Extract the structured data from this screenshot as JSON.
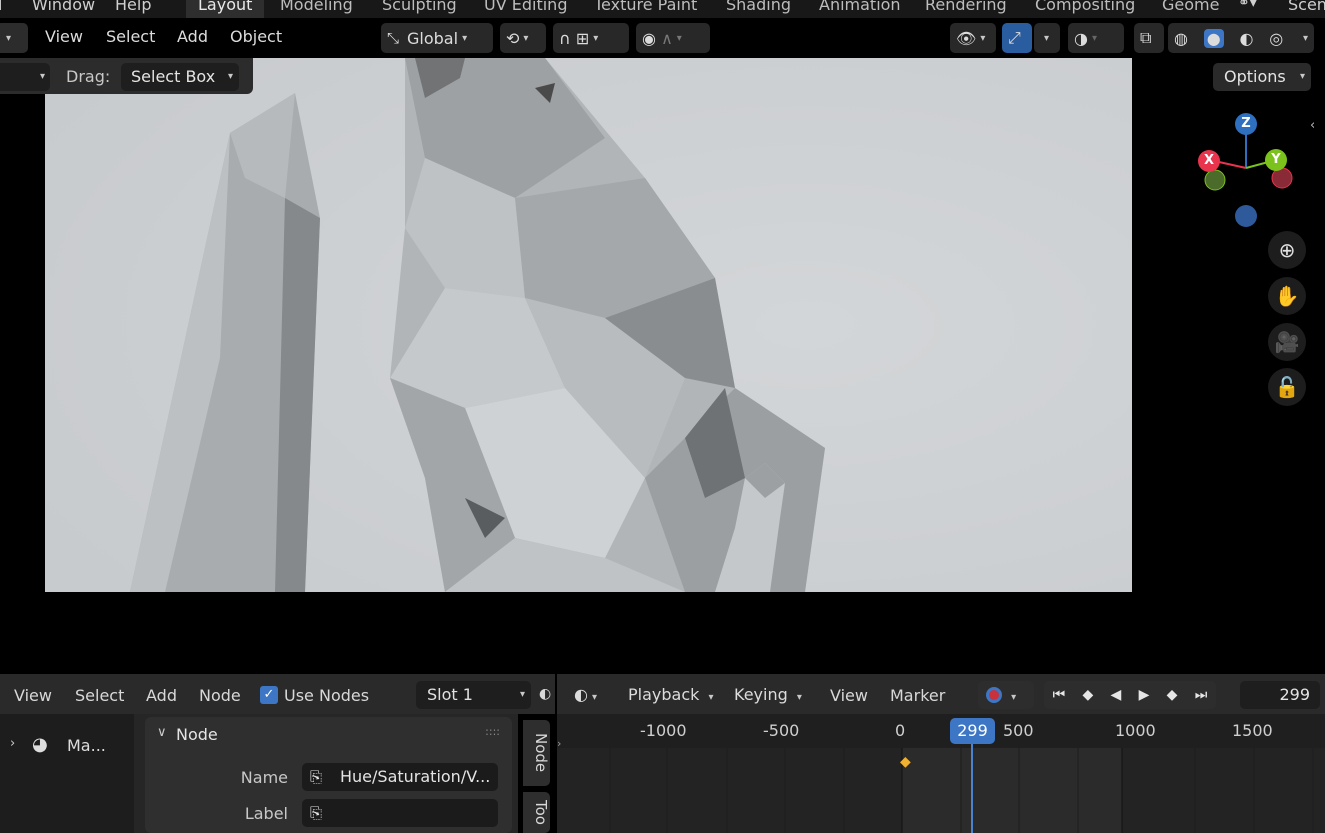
{
  "topbar": {
    "menus": [
      "Window",
      "Help"
    ],
    "workspace_tabs": [
      "Layout",
      "Modeling",
      "Sculpting",
      "UV Editing",
      "Texture Paint",
      "Shading",
      "Animation",
      "Rendering",
      "Compositing",
      "Geome"
    ],
    "active_tab": "Layout",
    "scene_label": "Scen"
  },
  "viewport_header": {
    "menus": [
      "View",
      "Select",
      "Add",
      "Object"
    ],
    "transform_orientation": "Global"
  },
  "tool_header": {
    "drag_label": "Drag:",
    "drag_value": "Select Box",
    "options_label": "Options"
  },
  "gizmo": {
    "x": "X",
    "y": "Y",
    "z": "Z",
    "colors": {
      "x": "#e8344c",
      "y": "#7cc21c",
      "z": "#2e6fc0"
    }
  },
  "node_editor": {
    "menus": [
      "View",
      "Select",
      "Add",
      "Node"
    ],
    "use_nodes_label": "Use Nodes",
    "slot": "Slot 1",
    "outliner_item": "Ma...",
    "panel_title": "Node",
    "name_label": "Name",
    "name_value": "Hue/Saturation/V...",
    "label_label": "Label",
    "label_value": "",
    "tabs": [
      "Node",
      "Too"
    ]
  },
  "timeline": {
    "playback_label": "Playback",
    "keying_label": "Keying",
    "menus": [
      "View",
      "Marker"
    ],
    "current_frame": "299",
    "ruler_ticks": [
      "-1000",
      "-500",
      "0",
      "500",
      "1000",
      "1500"
    ],
    "playhead": "299"
  }
}
